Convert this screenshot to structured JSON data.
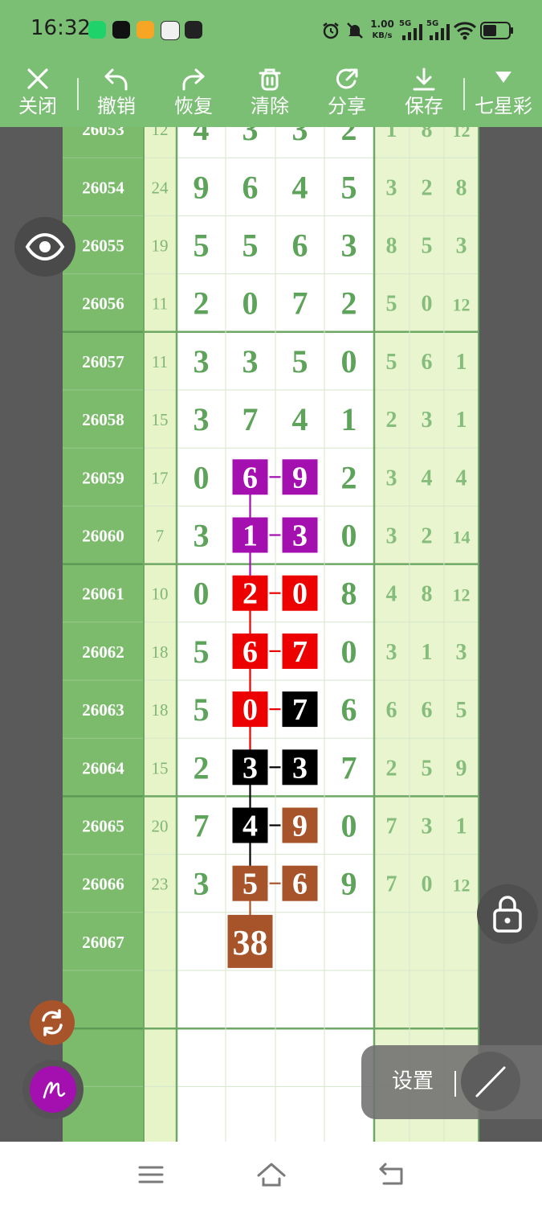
{
  "status_bar": {
    "time": "16:32",
    "net_speed_value": "1.00",
    "net_speed_unit": "KB/s",
    "sim1": "5G",
    "sim2": "5G"
  },
  "toolbar": {
    "close": "关闭",
    "undo": "撤销",
    "redo": "恢复",
    "clear": "清除",
    "share": "分享",
    "save": "保存",
    "lottery": "七星彩"
  },
  "board": {
    "columns": [
      "issue",
      "sum",
      "d1",
      "d2",
      "d3",
      "d4",
      "s1",
      "s2",
      "s3"
    ],
    "rows": [
      {
        "issue": "26053",
        "sum": "12",
        "digits": [
          "4",
          "3",
          "3",
          "2"
        ],
        "stats": [
          "1",
          "8",
          "12"
        ]
      },
      {
        "issue": "26054",
        "sum": "24",
        "digits": [
          "9",
          "6",
          "4",
          "5"
        ],
        "stats": [
          "3",
          "2",
          "8"
        ]
      },
      {
        "issue": "26055",
        "sum": "19",
        "digits": [
          "5",
          "5",
          "6",
          "3"
        ],
        "stats": [
          "8",
          "5",
          "3"
        ]
      },
      {
        "issue": "26056",
        "sum": "11",
        "digits": [
          "2",
          "0",
          "7",
          "2"
        ],
        "stats": [
          "5",
          "0",
          "12"
        ]
      },
      {
        "issue": "26057",
        "sum": "11",
        "digits": [
          "3",
          "3",
          "5",
          "0"
        ],
        "stats": [
          "5",
          "6",
          "1"
        ]
      },
      {
        "issue": "26058",
        "sum": "15",
        "digits": [
          "3",
          "7",
          "4",
          "1"
        ],
        "stats": [
          "2",
          "3",
          "1"
        ]
      },
      {
        "issue": "26059",
        "sum": "17",
        "digits": [
          "0",
          "6",
          "9",
          "2"
        ],
        "stats": [
          "3",
          "4",
          "4"
        ]
      },
      {
        "issue": "26060",
        "sum": "7",
        "digits": [
          "3",
          "1",
          "3",
          "0"
        ],
        "stats": [
          "3",
          "2",
          "14"
        ]
      },
      {
        "issue": "26061",
        "sum": "10",
        "digits": [
          "0",
          "2",
          "0",
          "8"
        ],
        "stats": [
          "4",
          "8",
          "12"
        ]
      },
      {
        "issue": "26062",
        "sum": "18",
        "digits": [
          "5",
          "6",
          "7",
          "0"
        ],
        "stats": [
          "3",
          "1",
          "3"
        ]
      },
      {
        "issue": "26063",
        "sum": "18",
        "digits": [
          "5",
          "0",
          "7",
          "6"
        ],
        "stats": [
          "6",
          "6",
          "5"
        ]
      },
      {
        "issue": "26064",
        "sum": "15",
        "digits": [
          "2",
          "3",
          "3",
          "7"
        ],
        "stats": [
          "2",
          "5",
          "9"
        ]
      },
      {
        "issue": "26065",
        "sum": "20",
        "digits": [
          "7",
          "4",
          "9",
          "0"
        ],
        "stats": [
          "7",
          "3",
          "1"
        ]
      },
      {
        "issue": "26066",
        "sum": "23",
        "digits": [
          "3",
          "5",
          "6",
          "9"
        ],
        "stats": [
          "7",
          "0",
          "12"
        ]
      },
      {
        "issue": "26067",
        "sum": "",
        "digits": [
          "",
          "38",
          "",
          ""
        ],
        "stats": [
          "",
          "",
          ""
        ]
      }
    ],
    "highlights": [
      {
        "row": 6,
        "cols": [
          1,
          2
        ],
        "color": "#a40fb0"
      },
      {
        "row": 7,
        "cols": [
          1,
          2
        ],
        "color": "#a40fb0"
      },
      {
        "row": 8,
        "cols": [
          1,
          2
        ],
        "color": "#ec0000"
      },
      {
        "row": 9,
        "cols": [
          1,
          2
        ],
        "color": "#ec0000"
      },
      {
        "row": 10,
        "cols": [
          1
        ],
        "color": "#ec0000"
      },
      {
        "row": 10,
        "cols": [
          2
        ],
        "color": "#000000"
      },
      {
        "row": 11,
        "cols": [
          1,
          2
        ],
        "color": "#000000"
      },
      {
        "row": 12,
        "cols": [
          1
        ],
        "color": "#000000"
      },
      {
        "row": 12,
        "cols": [
          2
        ],
        "color": "#a8542b"
      },
      {
        "row": 13,
        "cols": [
          1,
          2
        ],
        "color": "#a8542b"
      },
      {
        "row": 14,
        "cols": [
          1
        ],
        "color": "#a8542b"
      }
    ]
  },
  "overlay": {
    "settings_label": "设置"
  },
  "colors": {
    "bar_green": "#7bbf74",
    "issue_col": "#7cbb6c",
    "digit_green": "#5ea35a",
    "purple": "#a40fb0",
    "red": "#ec0000",
    "black": "#000000",
    "brown": "#a8542b"
  },
  "icons": {
    "close": "close-icon",
    "undo": "undo-icon",
    "redo": "redo-icon",
    "clear": "trash-icon",
    "share": "share-icon",
    "save": "download-icon",
    "lottery": "triangle-down-icon",
    "eye": "eye-icon",
    "lock": "lock-icon",
    "refresh": "refresh-icon",
    "pen": "pen-icon",
    "line": "line-tool-icon"
  }
}
